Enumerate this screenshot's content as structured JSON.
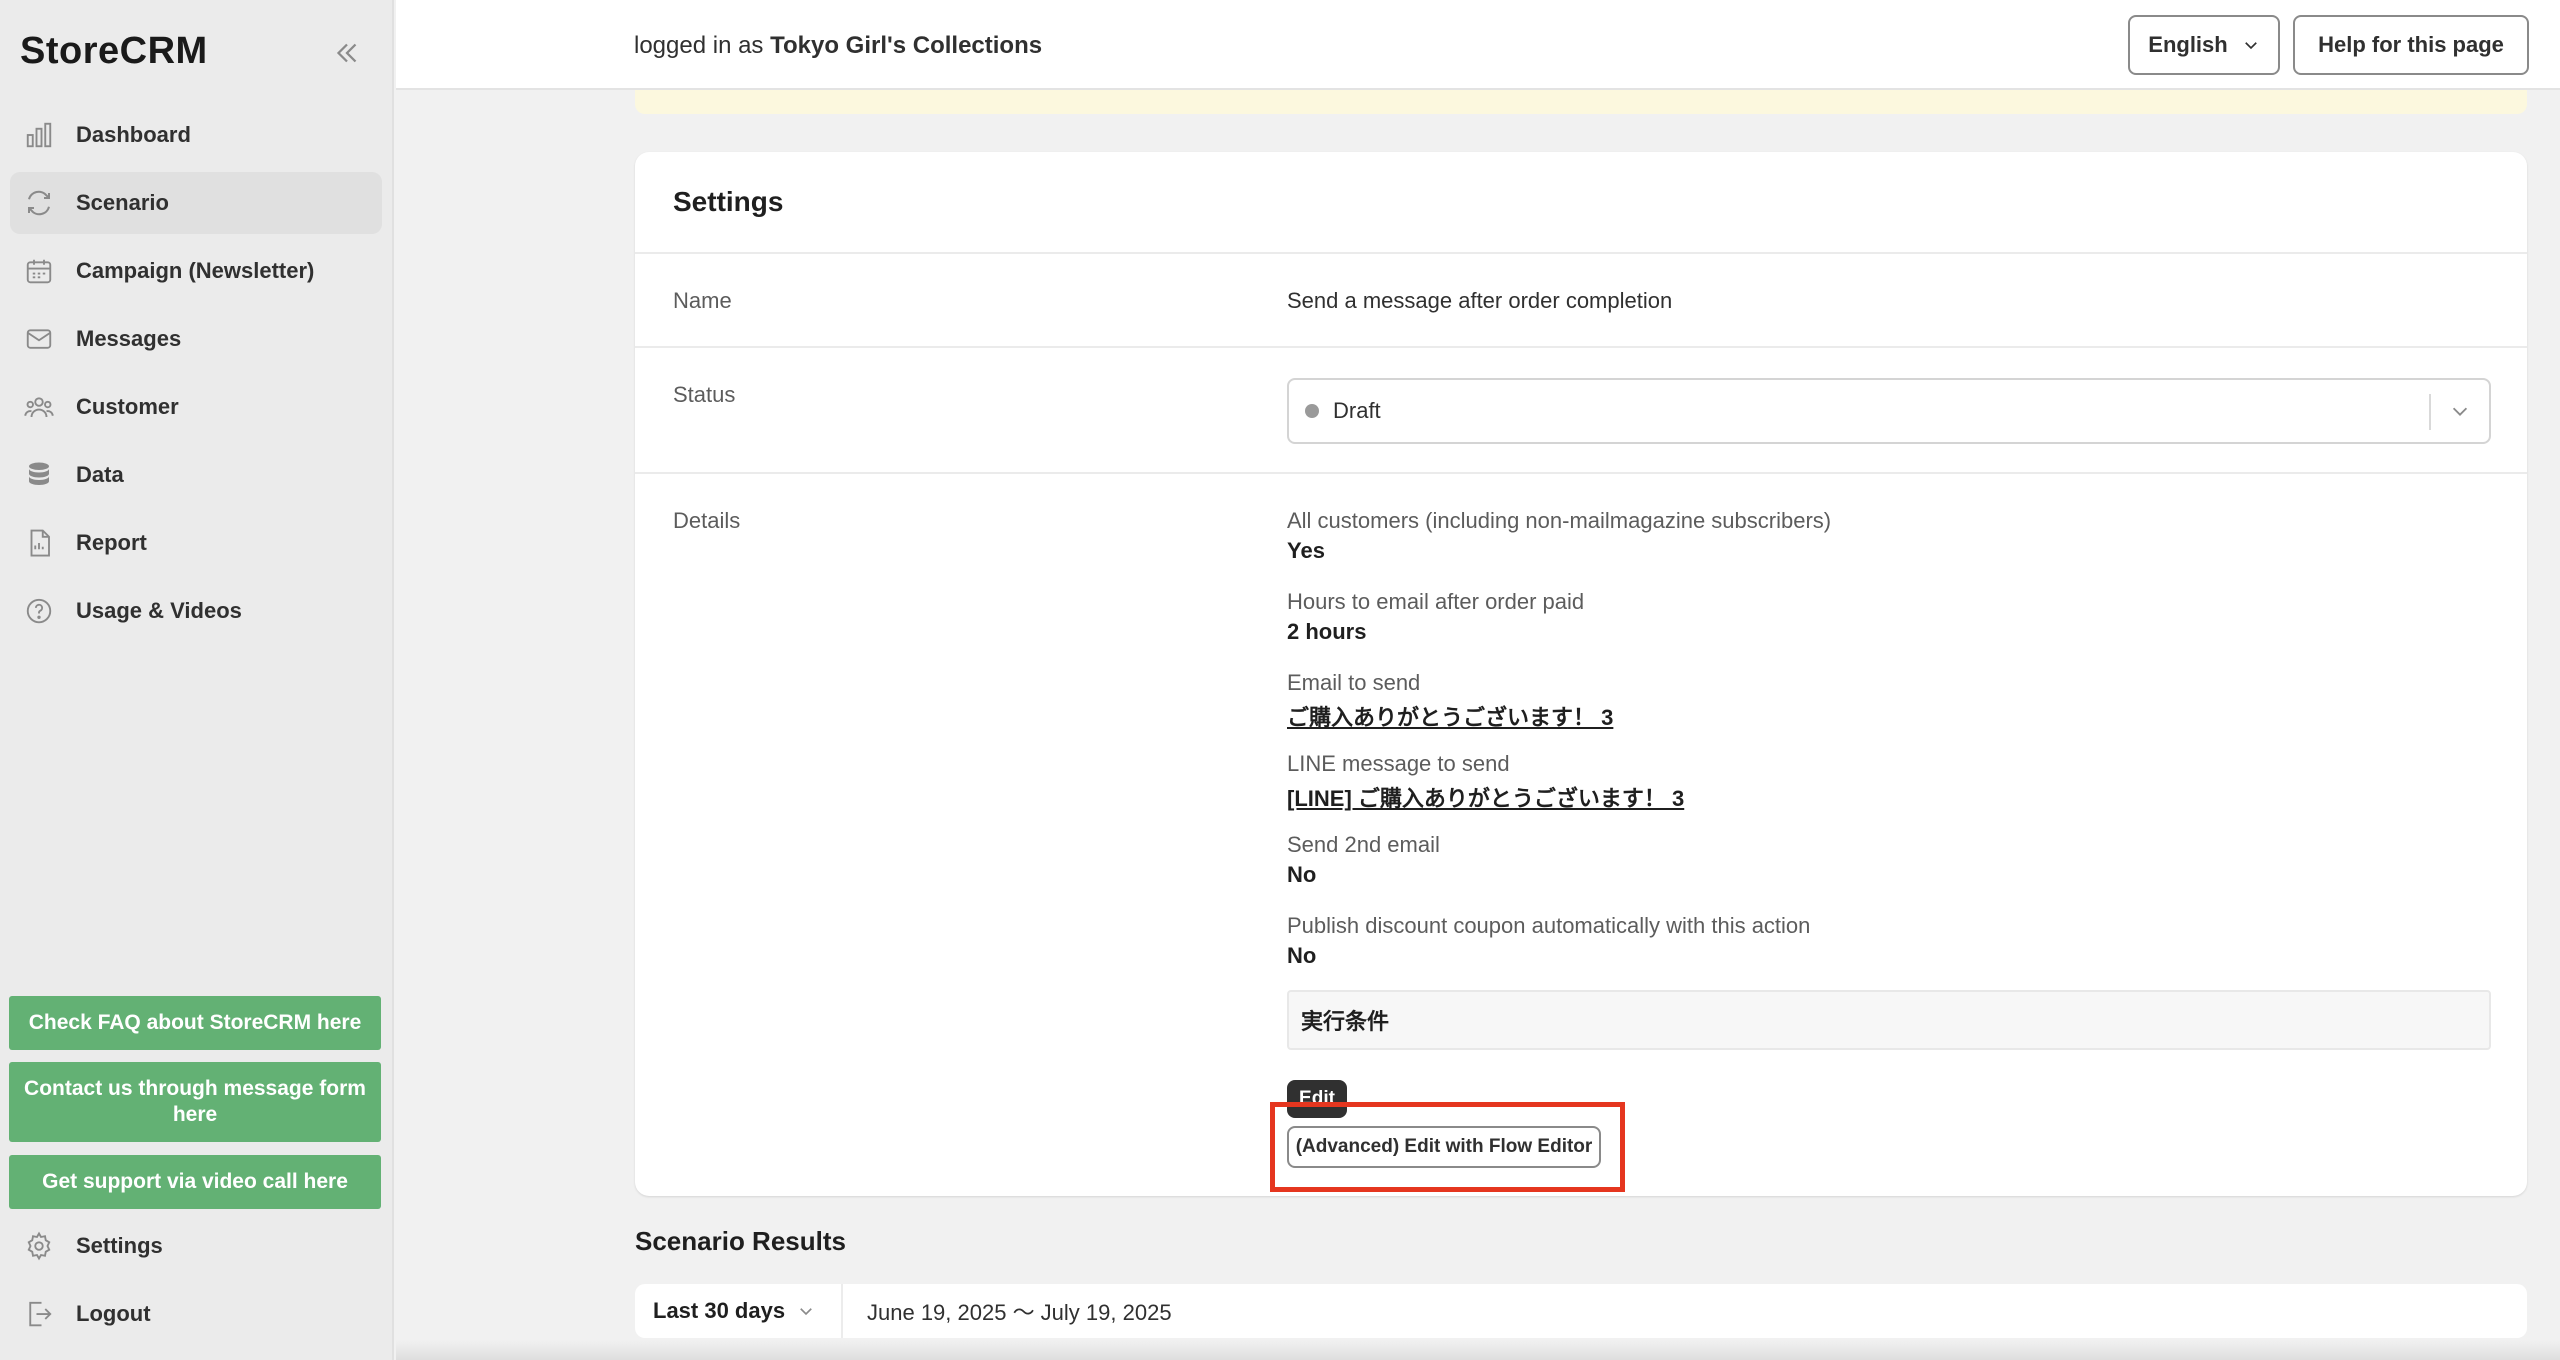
{
  "app": {
    "brand": "StoreCRM"
  },
  "sidebar": {
    "items": [
      {
        "label": "Dashboard",
        "icon": "bar-chart-icon"
      },
      {
        "label": "Scenario",
        "icon": "refresh-icon"
      },
      {
        "label": "Campaign (Newsletter)",
        "icon": "calendar-icon"
      },
      {
        "label": "Messages",
        "icon": "mail-icon"
      },
      {
        "label": "Customer",
        "icon": "people-icon"
      },
      {
        "label": "Data",
        "icon": "database-icon"
      },
      {
        "label": "Report",
        "icon": "document-icon"
      },
      {
        "label": "Usage & Videos",
        "icon": "help-circle-icon"
      }
    ],
    "active": "Scenario",
    "support_links": [
      "Check FAQ about StoreCRM here",
      "Contact us through message form here",
      "Get support via video call here"
    ],
    "bottom_items": [
      {
        "label": "Settings",
        "icon": "gear-icon"
      },
      {
        "label": "Logout",
        "icon": "logout-icon"
      }
    ],
    "support_color": "#63b174"
  },
  "topbar": {
    "logged_prefix": "logged in as ",
    "store_name": "Tokyo Girl's Collections",
    "language": "English",
    "help_label": "Help for this page"
  },
  "settings": {
    "title": "Settings",
    "name_label": "Name",
    "name_value": "Send a message after order completion",
    "status_label": "Status",
    "status_value": "Draft",
    "details_label": "Details",
    "details": [
      {
        "label": "All customers (including non-mailmagazine subscribers)",
        "value": "Yes",
        "link": false
      },
      {
        "label": "Hours to email after order paid",
        "value": "2 hours",
        "link": false
      },
      {
        "label": "Email to send",
        "value": "ご購入ありがとうございます！ 3",
        "link": true
      },
      {
        "label": "LINE message to send",
        "value": "[LINE] ご購入ありがとうございます！ 3",
        "link": true
      },
      {
        "label": "Send 2nd email",
        "value": "No",
        "link": false
      },
      {
        "label": "Publish discount coupon automatically with this action",
        "value": "No",
        "link": false
      }
    ],
    "condition_title": "実行条件",
    "edit_label": "Edit",
    "flow_editor_label": "(Advanced) Edit with Flow Editor",
    "highlight_color": "#e5361f"
  },
  "results": {
    "title": "Scenario Results",
    "range": "Last 30 days",
    "date_text": "June 19, 2025 〜 July 19, 2025"
  }
}
